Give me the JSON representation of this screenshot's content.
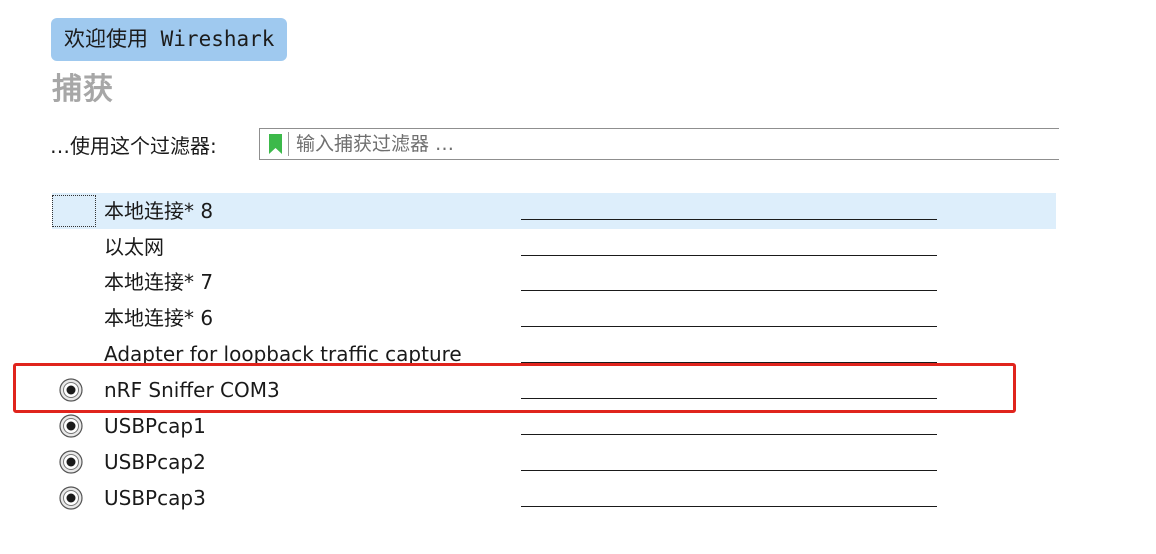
{
  "welcome": {
    "label": "欢迎使用 Wireshark"
  },
  "capture": {
    "title": "捕获",
    "filter_label": "…使用这个过滤器:",
    "filter_placeholder": "输入捕获过滤器 …",
    "filter_value": ""
  },
  "interfaces": [
    {
      "name": "本地连接* 8",
      "icon": "none",
      "selected": true
    },
    {
      "name": "以太网",
      "icon": "none",
      "selected": false
    },
    {
      "name": "本地连接* 7",
      "icon": "none",
      "selected": false
    },
    {
      "name": "本地连接* 6",
      "icon": "none",
      "selected": false
    },
    {
      "name": "Adapter for loopback traffic capture",
      "icon": "none",
      "selected": false
    },
    {
      "name": "nRF Sniffer COM3",
      "icon": "extcap-radio-icon",
      "selected": false,
      "highlighted": true
    },
    {
      "name": "USBPcap1",
      "icon": "extcap-radio-icon",
      "selected": false
    },
    {
      "name": "USBPcap2",
      "icon": "extcap-radio-icon",
      "selected": false
    },
    {
      "name": "USBPcap3",
      "icon": "extcap-radio-icon",
      "selected": false
    }
  ],
  "colors": {
    "welcome_bg": "#9fc9ef",
    "selected_row_bg": "#ddeefb",
    "highlight_border": "#e0241d",
    "bookmark_green": "#3cb94a",
    "title_gray": "#a7a7a7"
  }
}
